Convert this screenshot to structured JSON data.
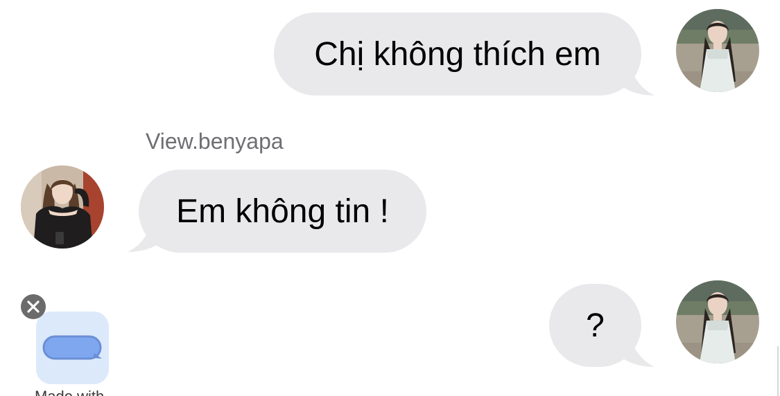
{
  "messages": [
    {
      "direction": "outgoing",
      "text": "Chị không thích em",
      "avatar_icon": "woman-white-dress-photo"
    },
    {
      "direction": "incoming",
      "sender": "View.benyapa",
      "text": "Em không tin !",
      "avatar_icon": "woman-black-top-photo"
    },
    {
      "direction": "outgoing",
      "text": "?",
      "avatar_icon": "woman-white-dress-photo"
    }
  ],
  "suggestion_tray": {
    "dismiss_icon": "close-icon",
    "app_icon": "message-bubble-icon",
    "label": "Made with..."
  },
  "colors": {
    "bubble": "#e9e9eb",
    "text": "#000000",
    "sender_name": "#6e6e73",
    "app_tile": "#dce9fb",
    "app_icon": "#7fa7ef"
  }
}
